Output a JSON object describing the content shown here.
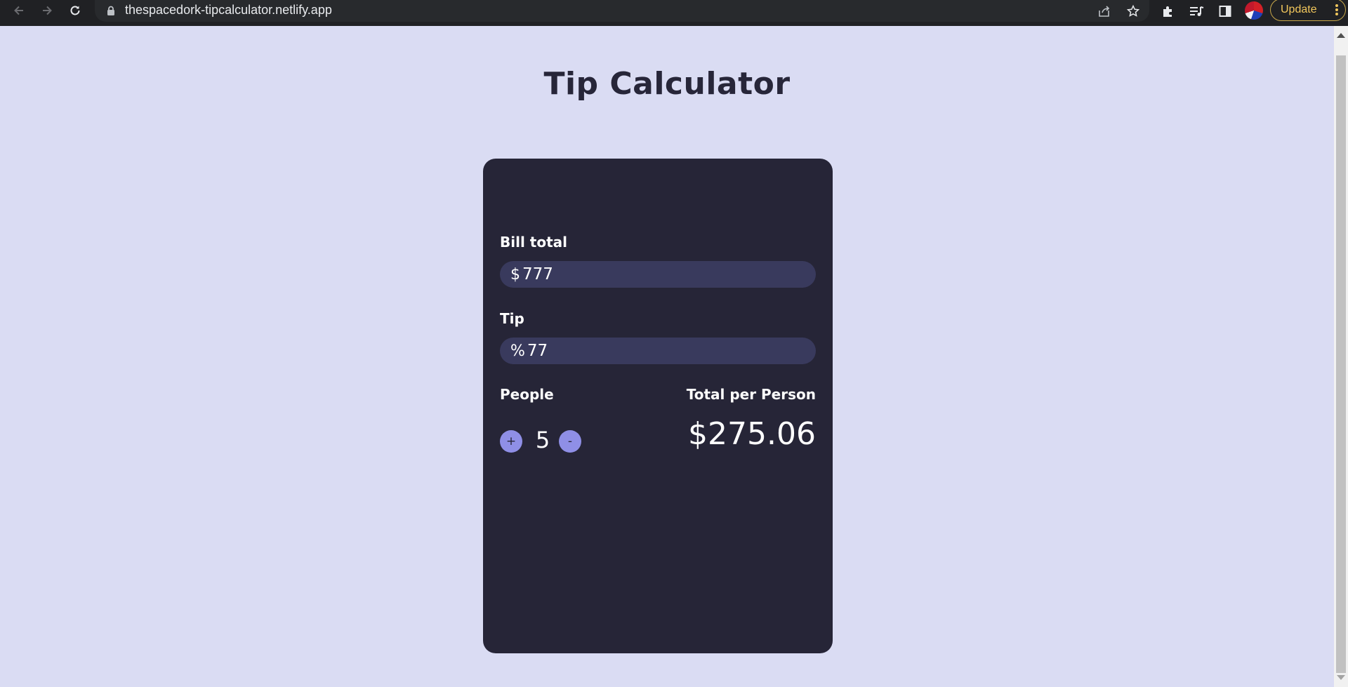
{
  "browser": {
    "url": "thespacedork-tipcalculator.netlify.app",
    "update_label": "Update",
    "icons": {
      "back": "back-arrow-icon",
      "forward": "forward-arrow-icon",
      "reload": "reload-icon",
      "lock": "lock-icon",
      "share": "share-icon",
      "bookmark": "star-icon",
      "extensions": "puzzle-icon",
      "media": "media-queue-icon",
      "side_panel": "side-panel-icon",
      "menu": "kebab-menu-icon"
    }
  },
  "page": {
    "title": "Tip Calculator"
  },
  "calculator": {
    "bill": {
      "label": "Bill total",
      "prefix": "$",
      "value": "777"
    },
    "tip": {
      "label": "Tip",
      "prefix": "%",
      "value": "77"
    },
    "people": {
      "label": "People",
      "increase_label": "+",
      "count": "5",
      "decrease_label": "-"
    },
    "total": {
      "label": "Total per Person",
      "value": "$275.06"
    }
  },
  "colors": {
    "page_background": "#dadcf3",
    "card_background": "#262537",
    "input_background": "#393a5d",
    "button_background": "#8f8fe6",
    "title_color": "#272639"
  }
}
